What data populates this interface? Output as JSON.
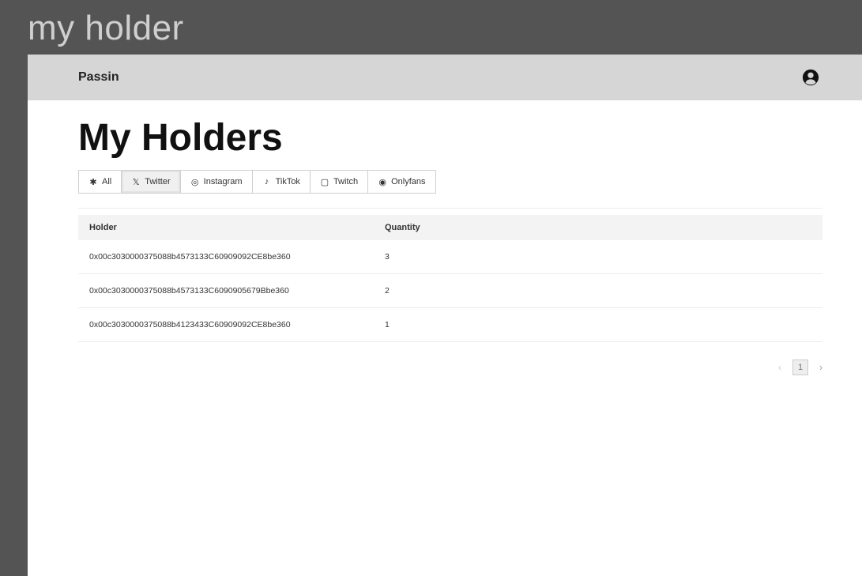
{
  "window_title": "my holder",
  "navbar": {
    "brand": "Passin",
    "user_icon": "user-circle-icon"
  },
  "page": {
    "title": "My Holders"
  },
  "filters": [
    {
      "label": "All",
      "icon": "star-icon",
      "glyph": "✱",
      "active": false
    },
    {
      "label": "Twitter",
      "icon": "x-icon",
      "glyph": "𝕏",
      "active": true
    },
    {
      "label": "Instagram",
      "icon": "instagram-icon",
      "glyph": "◎",
      "active": false
    },
    {
      "label": "TikTok",
      "icon": "tiktok-icon",
      "glyph": "♪",
      "active": false
    },
    {
      "label": "Twitch",
      "icon": "twitch-icon",
      "glyph": "▢",
      "active": false
    },
    {
      "label": "Onlyfans",
      "icon": "onlyfans-icon",
      "glyph": "◉",
      "active": false
    }
  ],
  "table": {
    "headers": {
      "holder": "Holder",
      "quantity": "Quantity"
    },
    "rows": [
      {
        "holder": "0x00c3030000375088b4573133C60909092CE8be360",
        "quantity": "3"
      },
      {
        "holder": "0x00c3030000375088b4573133C6090905679Bbe360",
        "quantity": "2"
      },
      {
        "holder": "0x00c3030000375088b4123433C60909092CE8be360",
        "quantity": "1"
      }
    ]
  },
  "pagination": {
    "prev": "‹",
    "current": "1",
    "next": "›"
  }
}
